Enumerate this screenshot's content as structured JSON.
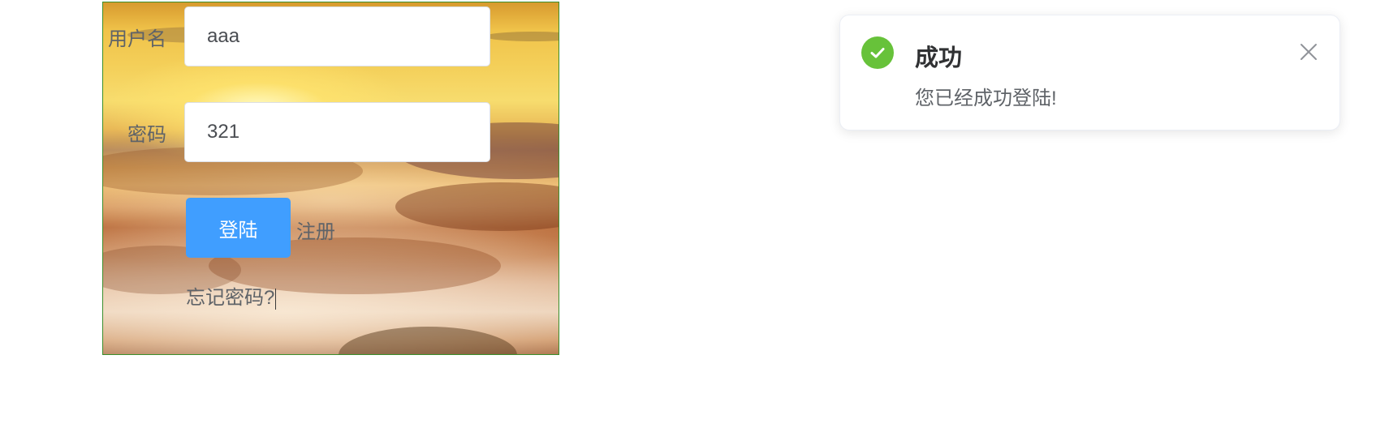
{
  "login_form": {
    "username_label": "用户名",
    "username_value": "aaa",
    "password_label": "密码",
    "password_value": "321",
    "login_button": "登陆",
    "register_link": "注册",
    "forgot_password_link": "忘记密码?"
  },
  "notification": {
    "type": "success",
    "icon": "check-circle-icon",
    "title": "成功",
    "message": "您已经成功登陆!",
    "close_icon": "close-icon",
    "accent_color": "#67c23a"
  },
  "colors": {
    "primary_button": "#409eff",
    "panel_border": "#3a8f2c"
  }
}
